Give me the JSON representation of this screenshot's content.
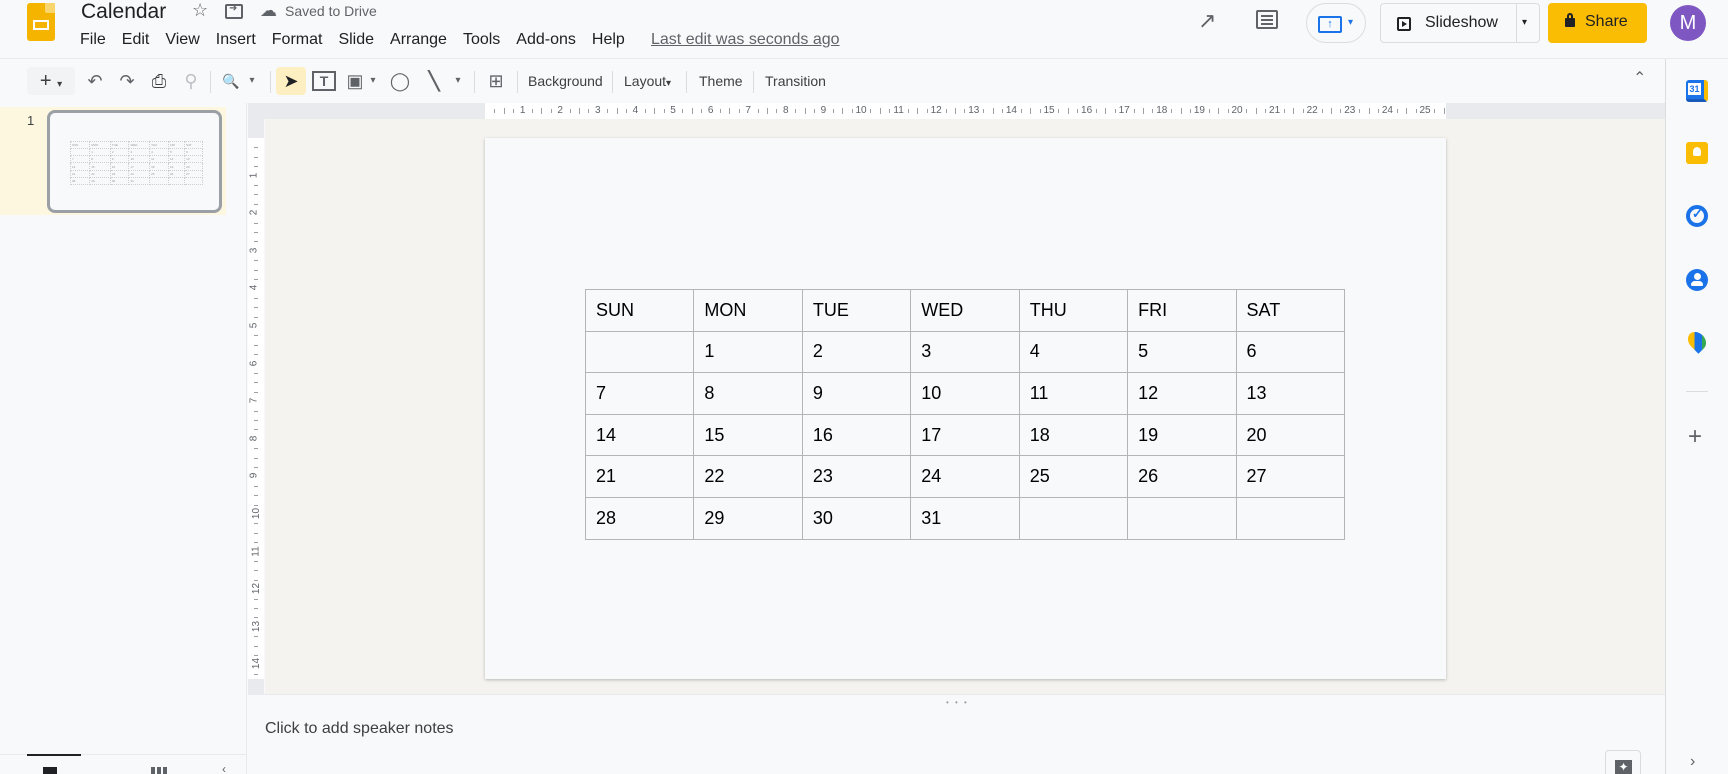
{
  "header": {
    "doc_title": "Calendar",
    "save_status": "Saved to Drive",
    "last_edit": "Last edit was seconds ago",
    "menu": [
      "File",
      "Edit",
      "View",
      "Insert",
      "Format",
      "Slide",
      "Arrange",
      "Tools",
      "Add-ons",
      "Help"
    ],
    "slideshow_label": "Slideshow",
    "share_label": "Share",
    "avatar_initial": "M",
    "icons": {
      "star": "☆",
      "cloud": "☁",
      "activity": "↗",
      "caret": "▾"
    },
    "colors": {
      "share": "#fbbc04",
      "avatar": "#7e57c2",
      "accent": "#1a73e8"
    }
  },
  "toolbar": {
    "new_icon": "+",
    "undo_icon": "↶",
    "redo_icon": "↷",
    "print_icon": "⎙",
    "paint_icon": "⚲",
    "zoom_icon": "🔍",
    "select_icon": "➤",
    "textbox_icon": "T",
    "image_icon": "▣",
    "shape_icon": "◯",
    "line_icon": "╲",
    "comment_icon": "⊞",
    "caret": "▾",
    "background_label": "Background",
    "layout_label": "Layout",
    "theme_label": "Theme",
    "transition_label": "Transition",
    "collapse_icon": "⌃"
  },
  "filmstrip": {
    "slides": [
      {
        "number": "1"
      }
    ]
  },
  "rulers": {
    "horizontal": [
      "1",
      "2",
      "3",
      "4",
      "5",
      "6",
      "7",
      "8",
      "9",
      "10",
      "11",
      "12",
      "13",
      "14",
      "15",
      "16",
      "17",
      "18",
      "19",
      "20",
      "21",
      "22",
      "23",
      "24",
      "25"
    ],
    "vertical": [
      "1",
      "2",
      "3",
      "4",
      "5",
      "6",
      "7",
      "8",
      "9",
      "10",
      "11",
      "12",
      "13",
      "14"
    ]
  },
  "slide": {
    "calendar": {
      "headers": [
        "SUN",
        "MON",
        "TUE",
        "WED",
        "THU",
        "FRI",
        "SAT"
      ],
      "rows": [
        [
          "",
          "1",
          "2",
          "3",
          "4",
          "5",
          "6"
        ],
        [
          "7",
          "8",
          "9",
          "10",
          "11",
          "12",
          "13"
        ],
        [
          "14",
          "15",
          "16",
          "17",
          "18",
          "19",
          "20"
        ],
        [
          "21",
          "22",
          "23",
          "24",
          "25",
          "26",
          "27"
        ],
        [
          "28",
          "29",
          "30",
          "31",
          "",
          "",
          ""
        ]
      ]
    }
  },
  "notes": {
    "placeholder": "Click to add speaker notes",
    "handle": "• • •",
    "explore_icon": "✦"
  },
  "side_panel": {
    "apps": [
      "calendar",
      "keep",
      "tasks",
      "contacts",
      "maps"
    ],
    "add_icon": "+",
    "expand_icon": "›"
  }
}
